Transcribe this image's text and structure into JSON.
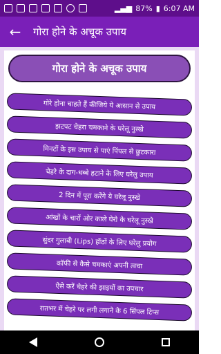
{
  "status": {
    "battery": "87%",
    "time": "6:07 AM"
  },
  "header": {
    "title": "गोरा होने के अचूक उपाय"
  },
  "list": {
    "heading": "गोरा होने के अचूक उपाय",
    "items": [
      "गोरे होना चाहते हैं कीजिये ये आसान से उपाय",
      "झटपट चेहरा चमकाने के घरेलू नुस्खे",
      "मिनटों के इस उपाय से पाएं पिंपल से छुटकारा",
      "चेहरे के दाग-धब्बे हटाने के लिए घरेलु उपाय",
      "2 दिन में पूरा करेंगे ये घरेलू नुस्खे",
      "आंखों के चारों ओर काले घेरो के घरेलू नुस्खे",
      "सुंदर गुलाबी (Lips) होंठों के लिए घरेलु प्रयोग",
      "कॉफी से कैसे चमकाएं अपनी त्वचा",
      "ऐसे करें चेहरे की झाइयों का उपचार",
      "रातभर में चेहरे पर लगी लगाने के 6 सिंपल टिप्स"
    ]
  },
  "colors": {
    "status_bar": "#5e0e8b",
    "app_bar": "#7a1fb8",
    "item_bg": "#7a2fb8",
    "heading_bg": "#8a4fb6",
    "content_bg": "#ead9f4"
  },
  "icons": {
    "back": "arrow-left-icon",
    "nav_back": "triangle-back-icon",
    "nav_home": "circle-home-icon",
    "nav_recent": "square-recent-icon"
  }
}
